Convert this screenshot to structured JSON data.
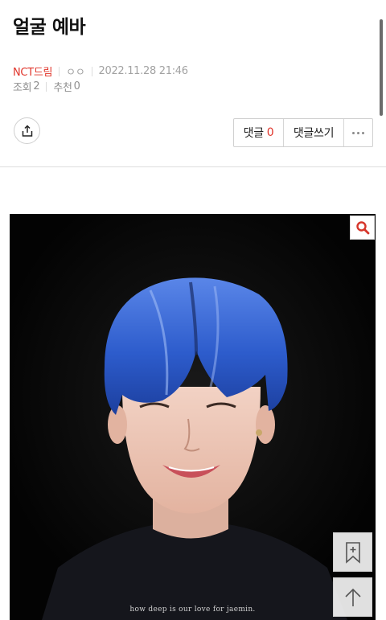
{
  "post": {
    "title": "얼굴 예바",
    "board": "NCT드림",
    "author": "ㅇㅇ",
    "datetime": "2022.11.28 21:46",
    "views_label": "조회",
    "views": "2",
    "likes_label": "추천",
    "likes": "0"
  },
  "actions": {
    "comment_label": "댓글",
    "comment_count": "0",
    "write_comment_label": "댓글쓰기"
  },
  "image": {
    "caption": "how deep is our love for jaemin."
  },
  "icons": {
    "share": "share-icon",
    "more": "more-dots-icon",
    "zoom": "search-icon",
    "bookmark": "bookmark-add-icon",
    "scroll_top": "arrow-up-icon"
  },
  "colors": {
    "accent": "#e0342a",
    "muted_text": "#a2a2a2",
    "hair": "#2f5fd0"
  }
}
